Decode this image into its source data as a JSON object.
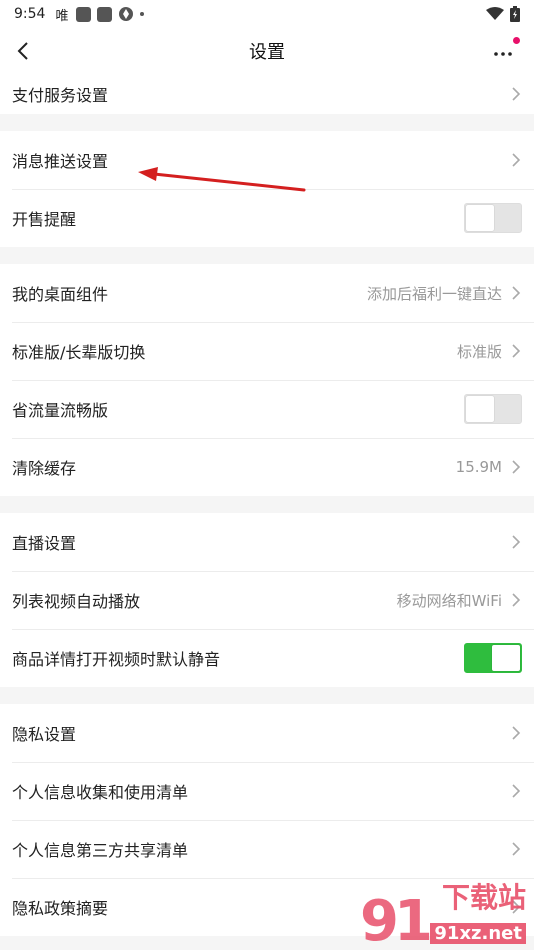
{
  "status_bar": {
    "time": "9:54",
    "carrier": "唯"
  },
  "header": {
    "title": "设置"
  },
  "groups": [
    [
      {
        "label": "支付服务设置"
      }
    ],
    [
      {
        "label": "消息推送设置"
      },
      {
        "label": "开售提醒"
      }
    ],
    [
      {
        "label": "我的桌面组件",
        "value": "添加后福利一键直达"
      },
      {
        "label": "标准版/长辈版切换",
        "value": "标准版"
      },
      {
        "label": "省流量流畅版"
      },
      {
        "label": "清除缓存",
        "value": "15.9M"
      }
    ],
    [
      {
        "label": "直播设置"
      },
      {
        "label": "列表视频自动播放",
        "value": "移动网络和WiFi"
      },
      {
        "label": "商品详情打开视频时默认静音"
      }
    ],
    [
      {
        "label": "隐私设置"
      },
      {
        "label": "个人信息收集和使用清单"
      },
      {
        "label": "个人信息第三方共享清单"
      },
      {
        "label": "隐私政策摘要"
      }
    ]
  ],
  "toggles": {
    "sale_reminder": false,
    "data_saver": false,
    "mute_video": true
  },
  "watermark": {
    "brand": "下载站",
    "domain": "91xz.net"
  },
  "colors": {
    "toggle_on": "#2fbd3e",
    "annotation_arrow": "#d41f1f",
    "notify_dot": "#e8106a"
  },
  "icons": {
    "back": "back-icon",
    "more": "more-icon",
    "chevron": "chevron-right-icon"
  }
}
